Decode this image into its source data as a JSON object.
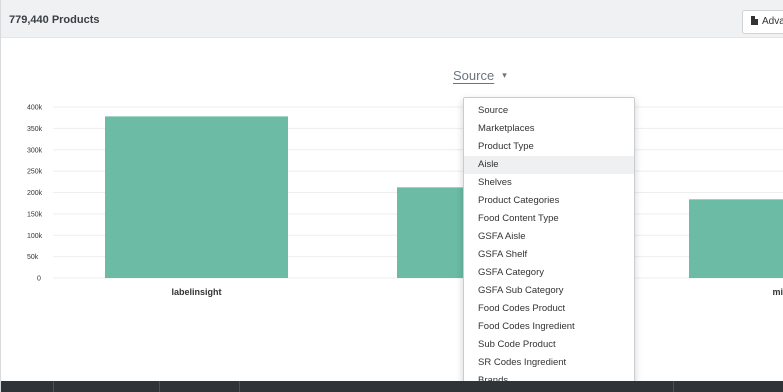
{
  "header": {
    "product_count": "779,440 Products",
    "advanced_button_label": "Adva"
  },
  "chart_selector": {
    "label": "Source",
    "caret": "▾"
  },
  "chart_data": {
    "type": "bar",
    "categories": [
      "labelinsight",
      "",
      "min"
    ],
    "values": [
      378000,
      212000,
      184000
    ],
    "ylim": [
      0,
      400000
    ],
    "y_ticks": [
      "400k",
      "350k",
      "300k",
      "250k",
      "200k",
      "150k",
      "100k",
      "50k",
      "0"
    ],
    "bar_color": "#6cbba4",
    "grid": true
  },
  "dropdown": {
    "active_index": 3,
    "items": [
      "Source",
      "Marketplaces",
      "Product Type",
      "Aisle",
      "Shelves",
      "Product Categories",
      "Food Content Type",
      "GSFA Aisle",
      "GSFA Shelf",
      "GSFA Category",
      "GSFA Sub Category",
      "Food Codes Product",
      "Food Codes Ingredient",
      "Sub Code Product",
      "SR Codes Ingredient",
      "Brands"
    ]
  },
  "colors": {
    "bar": "#6cbba4",
    "header_bg": "#f0f1f2",
    "table_header_bg": "#2f3439"
  }
}
